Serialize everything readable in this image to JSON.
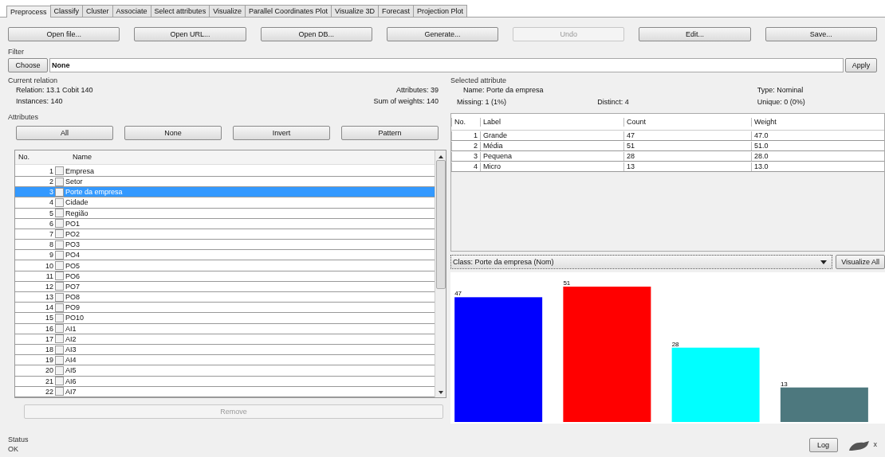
{
  "tabs": [
    {
      "label": "Preprocess",
      "selected": true
    },
    {
      "label": "Classify",
      "selected": false
    },
    {
      "label": "Cluster",
      "selected": false
    },
    {
      "label": "Associate",
      "selected": false
    },
    {
      "label": "Select attributes",
      "selected": false
    },
    {
      "label": "Visualize",
      "selected": false
    },
    {
      "label": "Parallel Coordinates Plot",
      "selected": false
    },
    {
      "label": "Visualize 3D",
      "selected": false
    },
    {
      "label": "Forecast",
      "selected": false
    },
    {
      "label": "Projection Plot",
      "selected": false
    }
  ],
  "toolbar": [
    {
      "label": "Open file...",
      "disabled": false
    },
    {
      "label": "Open URL...",
      "disabled": false
    },
    {
      "label": "Open DB...",
      "disabled": false
    },
    {
      "label": "Generate...",
      "disabled": false
    },
    {
      "label": "Undo",
      "disabled": true
    },
    {
      "label": "Edit...",
      "disabled": false
    },
    {
      "label": "Save...",
      "disabled": false
    }
  ],
  "filter": {
    "title": "Filter",
    "choose": "Choose",
    "value": "None",
    "apply": "Apply"
  },
  "current_relation": {
    "title": "Current relation",
    "relation_label": "Relation:",
    "relation": "13.1 Cobit 140",
    "instances_label": "Instances:",
    "instances": "140",
    "attributes_label": "Attributes:",
    "attributes": "39",
    "weights_label": "Sum of weights:",
    "weights": "140"
  },
  "attributes": {
    "title": "Attributes",
    "buttons": [
      "All",
      "None",
      "Invert",
      "Pattern"
    ],
    "columns": [
      "No.",
      "Name"
    ],
    "rows": [
      {
        "no": "1",
        "name": "Empresa",
        "checked": false,
        "selected": false
      },
      {
        "no": "2",
        "name": "Setor",
        "checked": false,
        "selected": false
      },
      {
        "no": "3",
        "name": "Porte da empresa",
        "checked": false,
        "selected": true
      },
      {
        "no": "4",
        "name": "Cidade",
        "checked": false,
        "selected": false
      },
      {
        "no": "5",
        "name": "Região",
        "checked": false,
        "selected": false
      },
      {
        "no": "6",
        "name": "PO1",
        "checked": false,
        "selected": false
      },
      {
        "no": "7",
        "name": "PO2",
        "checked": false,
        "selected": false
      },
      {
        "no": "8",
        "name": "PO3",
        "checked": false,
        "selected": false
      },
      {
        "no": "9",
        "name": "PO4",
        "checked": false,
        "selected": false
      },
      {
        "no": "10",
        "name": "PO5",
        "checked": false,
        "selected": false
      },
      {
        "no": "11",
        "name": "PO6",
        "checked": false,
        "selected": false
      },
      {
        "no": "12",
        "name": "PO7",
        "checked": false,
        "selected": false
      },
      {
        "no": "13",
        "name": "PO8",
        "checked": false,
        "selected": false
      },
      {
        "no": "14",
        "name": "PO9",
        "checked": false,
        "selected": false
      },
      {
        "no": "15",
        "name": "PO10",
        "checked": false,
        "selected": false
      },
      {
        "no": "16",
        "name": "AI1",
        "checked": false,
        "selected": false
      },
      {
        "no": "17",
        "name": "AI2",
        "checked": false,
        "selected": false
      },
      {
        "no": "18",
        "name": "AI3",
        "checked": false,
        "selected": false
      },
      {
        "no": "19",
        "name": "AI4",
        "checked": false,
        "selected": false
      },
      {
        "no": "20",
        "name": "AI5",
        "checked": false,
        "selected": false
      },
      {
        "no": "21",
        "name": "AI6",
        "checked": false,
        "selected": false
      },
      {
        "no": "22",
        "name": "AI7",
        "checked": false,
        "selected": false
      }
    ],
    "remove": {
      "label": "Remove",
      "disabled": true
    }
  },
  "selected_attribute": {
    "title": "Selected attribute",
    "name_label": "Name:",
    "name": "Porte da empresa",
    "type_label": "Type:",
    "type": "Nominal",
    "missing_label": "Missing:",
    "missing": "1 (1%)",
    "distinct_label": "Distinct:",
    "distinct": "4",
    "unique_label": "Unique:",
    "unique": "0 (0%)",
    "columns": [
      "No.",
      "Label",
      "Count",
      "Weight"
    ],
    "rows": [
      [
        "1",
        "Grande",
        "47",
        "47.0"
      ],
      [
        "2",
        "Média",
        "51",
        "51.0"
      ],
      [
        "3",
        "Pequena",
        "28",
        "28.0"
      ],
      [
        "4",
        "Micro",
        "13",
        "13.0"
      ]
    ]
  },
  "class_select": {
    "value": "Class: Porte da empresa (Nom)"
  },
  "visualize_all": "Visualize All",
  "chart_data": {
    "type": "bar",
    "data_labels": true,
    "series": [
      {
        "color": "#0000ff",
        "values": [
          47
        ]
      },
      {
        "color": "#ff0000",
        "values": [
          51
        ]
      },
      {
        "color": "#00ffff",
        "values": [
          28
        ]
      },
      {
        "color": "#4d787e",
        "values": [
          13
        ]
      }
    ]
  },
  "status": {
    "title": "Status",
    "text": "OK",
    "log": "Log",
    "close": "x"
  }
}
